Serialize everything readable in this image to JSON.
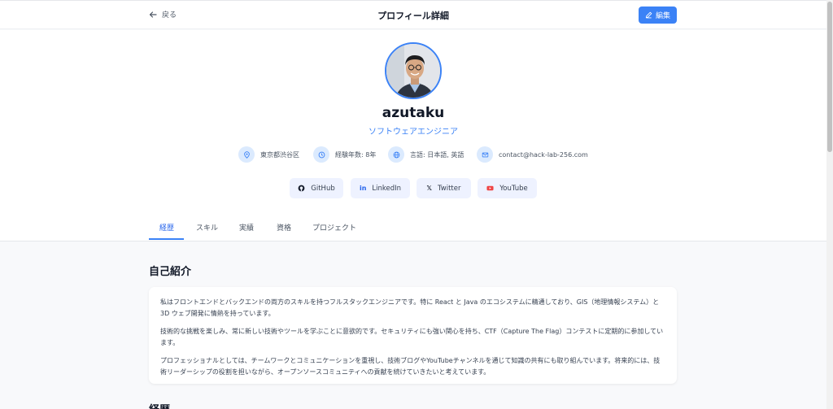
{
  "header": {
    "back_label": "戻る",
    "title": "プロフィール詳細",
    "edit_label": "編集"
  },
  "profile": {
    "name": "azutaku",
    "role": "ソフトウェアエンジニア",
    "info": {
      "location": "東京都渋谷区",
      "experience": "経験年数: 8年",
      "languages": "言語: 日本語, 英語",
      "email": "contact@hack-lab-256.com"
    },
    "social": [
      {
        "label": "GitHub",
        "icon": "github-icon"
      },
      {
        "label": "LinkedIn",
        "icon": "linkedin-icon"
      },
      {
        "label": "Twitter",
        "icon": "x-icon"
      },
      {
        "label": "YouTube",
        "icon": "youtube-icon"
      }
    ]
  },
  "tabs": [
    "経歴",
    "スキル",
    "実績",
    "資格",
    "プロジェクト"
  ],
  "active_tab": "経歴",
  "intro": {
    "title": "自己紹介",
    "paragraphs": [
      "私はフロントエンドとバックエンドの両方のスキルを持つフルスタックエンジニアです。特に React と Java のエコシステムに精通しており、GIS（地理情報システム）と 3D ウェブ開発に情熱を持っています。",
      "技術的な挑戦を楽しみ、常に新しい技術やツールを学ぶことに意欲的です。セキュリティにも強い関心を持ち、CTF（Capture The Flag）コンテストに定期的に参加しています。",
      "プロフェッショナルとしては、チームワークとコミュニケーションを重視し、技術ブログやYouTubeチャンネルを通じて知識の共有にも取り組んでいます。将来的には、技術リーダーシップの役割を担いながら、オープンソースコミュニティへの貢献を続けていきたいと考えています。"
    ]
  },
  "next_section_title": "経歴",
  "colors": {
    "accent": "#3b82f6",
    "icon_bg": "#dbeafe",
    "social_bg": "#eef2ff",
    "page_bg": "#f8f9fb"
  }
}
